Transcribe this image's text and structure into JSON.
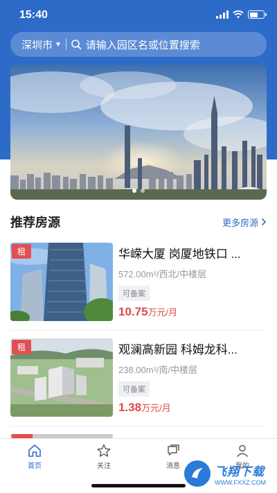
{
  "status": {
    "time": "15:40"
  },
  "search": {
    "city": "深圳市",
    "placeholder": "请输入园区名或位置搜索"
  },
  "banner": {
    "slides": 2,
    "active_slide": 1
  },
  "section": {
    "title": "推荐房源",
    "more_label": "更多房源"
  },
  "listings": [
    {
      "tag": "租",
      "title": "华嵘大厦 岗厦地铁口 ...",
      "meta": "572.00m²/西北/中楼层",
      "badge": "可备案",
      "price": "10.75",
      "price_unit": "万元/月"
    },
    {
      "tag": "租",
      "title": "观澜高新园 科姆龙科...",
      "meta": "238.00m²/南/中楼层",
      "badge": "可备案",
      "price": "1.38",
      "price_unit": "万元/月"
    }
  ],
  "tabs": [
    {
      "label": "首页",
      "icon": "home-icon",
      "active": true
    },
    {
      "label": "关注",
      "icon": "star-icon",
      "active": false
    },
    {
      "label": "消息",
      "icon": "message-icon",
      "active": false
    },
    {
      "label": "我的",
      "icon": "user-icon",
      "active": false
    }
  ],
  "watermark": {
    "main": "飞翔下载",
    "sub": "WWW.FXXZ.COM"
  },
  "colors": {
    "brand": "#2d6bc8",
    "price": "#e04848",
    "tag": "#e24e52"
  }
}
